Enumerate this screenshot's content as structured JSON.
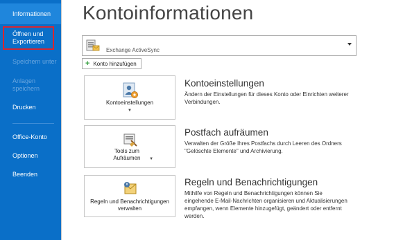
{
  "sidebar": {
    "items": [
      {
        "label": "Informationen",
        "state": "active"
      },
      {
        "label": "Öffnen und Exportieren",
        "state": "normal"
      },
      {
        "label": "Speichern unter",
        "state": "disabled"
      },
      {
        "label": "Anlagen speichern",
        "state": "disabled"
      },
      {
        "label": "Drucken",
        "state": "normal"
      },
      {
        "label": "Office-Konto",
        "state": "normal"
      },
      {
        "label": "Optionen",
        "state": "normal"
      },
      {
        "label": "Beenden",
        "state": "normal"
      }
    ]
  },
  "page": {
    "title": "Kontoinformationen"
  },
  "account": {
    "selected": "Exchange ActiveSync",
    "add_label": "Konto hinzufügen"
  },
  "sections": [
    {
      "button_label": "Kontoeinstellungen",
      "title": "Kontoeinstellungen",
      "description": "Ändern der Einstellungen für dieses Konto oder Einrichten weiterer Verbindungen."
    },
    {
      "button_label": "Tools zum Aufräumen",
      "title": "Postfach aufräumen",
      "description": "Verwalten der Größe Ihres Postfachs durch Leeren des Ordners \"Gelöschte Elemente\" und Archivierung."
    },
    {
      "button_label": "Regeln und Benachrichtigungen verwalten",
      "title": "Regeln und Benachrichtigungen",
      "description": "Mithilfe von Regeln und Benachrichtigungen können Sie eingehende E-Mail-Nachrichten organisieren und Aktualisierungen empfangen, wenn Elemente hinzugefügt, geändert oder entfernt werden."
    }
  ],
  "colors": {
    "sidebar_bg": "#0a6fc8",
    "sidebar_active": "#1f86dc",
    "highlight_border": "#d9262f"
  }
}
